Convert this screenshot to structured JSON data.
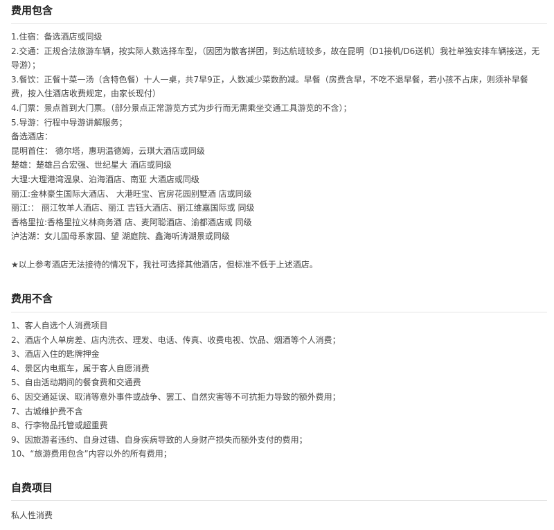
{
  "included": {
    "title": "费用包含",
    "items": [
      "1.住宿：备选酒店或同级",
      "2.交通：正规合法旅游车辆，按实际人数选择车型，（因团为散客拼团，到达航班较多，故在昆明（D1接机/D6送机）我社单独安排车辆接送，无导游）；",
      "3.餐饮：正餐十菜一汤（含特色餐）十人一桌，共7早9正，人数减少菜数酌减。早餐（房费含早，不吃不退早餐，若小孩不占床，则须补早餐费，按入住酒店收费规定，由家长现付）",
      "4.门票：景点首到大门票。（部分景点正常游览方式为步行而无需乘坐交通工具游览的不含）；",
      "5.导游：行程中导游讲解服务；"
    ],
    "hotels": [
      "备选酒店：",
      "昆明首住： 德尔塔，惠玥温德姆，云琪大酒店或同级",
      "楚雄：楚雄吕合宏强、世纪星大 酒店或同级",
      "大理:大理港湾温泉、泊海酒店、南亚 大酒店或同级",
      "丽江:金林豪生国际大酒店、 大港旺宝、官房花园别墅酒 店或同级",
      "丽江:： 丽江牧羊人酒店、丽江 吉钰大酒店、丽江维嘉国际或 同级",
      "香格里拉:香格里拉义林商务酒 店、麦阿聪酒店、渝都酒店或 同级",
      "泸沽湖：女儿国母系家园、望 湖庭院、鑫海听涛湖景或同级"
    ],
    "note": "★以上参考酒店无法接待的情况下，我社可选择其他酒店，但标准不低于上述酒店。"
  },
  "excluded": {
    "title": "费用不含",
    "items": [
      "1、客人自选个人消费项目",
      "2、酒店个人单房差、店内洗衣、理发、电话、传真、收费电视、饮品、烟酒等个人消费；",
      "3、酒店入住的匙牌押金",
      "4、景区内电瓶车，属于客人自愿消费",
      "5、自由活动期间的餐食费和交通费",
      "6、因交通延误、取消等意外事件或战争、罢工、自然灾害等不可抗拒力导致的额外费用；",
      "7、古城维护费不含",
      "8、行李物品托管或超重费",
      "9、因旅游者违约、自身过错、自身疾病导致的人身财产损失而额外支付的费用；",
      "10、“旅游费用包含”内容以外的所有费用；"
    ]
  },
  "self_pay": {
    "title": "自费项目",
    "items": [
      "私人性消费"
    ]
  }
}
